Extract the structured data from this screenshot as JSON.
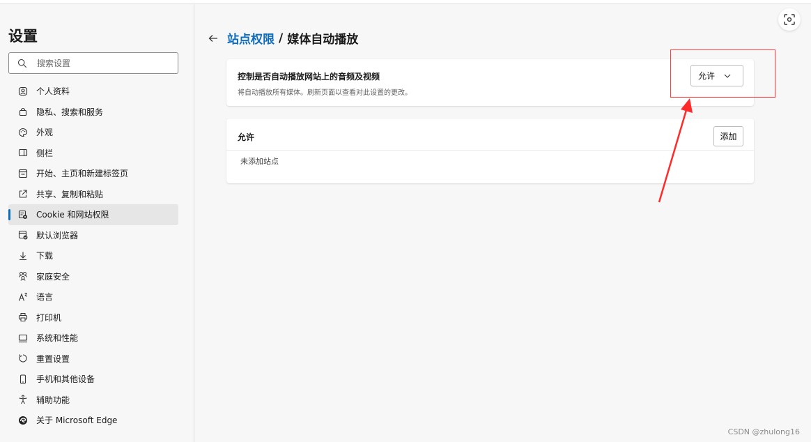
{
  "sidebar": {
    "title": "设置",
    "search_placeholder": "搜索设置",
    "items": [
      {
        "label": "个人资料",
        "icon": "profile-icon"
      },
      {
        "label": "隐私、搜索和服务",
        "icon": "lock-icon"
      },
      {
        "label": "外观",
        "icon": "palette-icon"
      },
      {
        "label": "侧栏",
        "icon": "sidebar-icon"
      },
      {
        "label": "开始、主页和新建标签页",
        "icon": "home-icon"
      },
      {
        "label": "共享、复制和粘贴",
        "icon": "share-icon"
      },
      {
        "label": "Cookie 和网站权限",
        "icon": "cookie-icon",
        "active": true
      },
      {
        "label": "默认浏览器",
        "icon": "browser-icon"
      },
      {
        "label": "下载",
        "icon": "download-icon"
      },
      {
        "label": "家庭安全",
        "icon": "family-icon"
      },
      {
        "label": "语言",
        "icon": "language-icon"
      },
      {
        "label": "打印机",
        "icon": "printer-icon"
      },
      {
        "label": "系统和性能",
        "icon": "system-icon"
      },
      {
        "label": "重置设置",
        "icon": "reset-icon"
      },
      {
        "label": "手机和其他设备",
        "icon": "phone-icon"
      },
      {
        "label": "辅助功能",
        "icon": "accessibility-icon"
      },
      {
        "label": "关于 Microsoft Edge",
        "icon": "edge-icon"
      }
    ]
  },
  "header": {
    "breadcrumb_link": "站点权限",
    "separator": "/",
    "current": "媒体自动播放"
  },
  "autoplay_card": {
    "title": "控制是否自动播放网站上的音频及视频",
    "description": "将自动播放所有媒体。刷新页面以查看对此设置的更改。",
    "dropdown_value": "允许"
  },
  "allow_card": {
    "title": "允许",
    "add_label": "添加",
    "empty_text": "未添加站点"
  },
  "watermark": "CSDN @zhulong16",
  "colors": {
    "accent": "#0f6cbd",
    "annotation": "#ff3b3b"
  }
}
